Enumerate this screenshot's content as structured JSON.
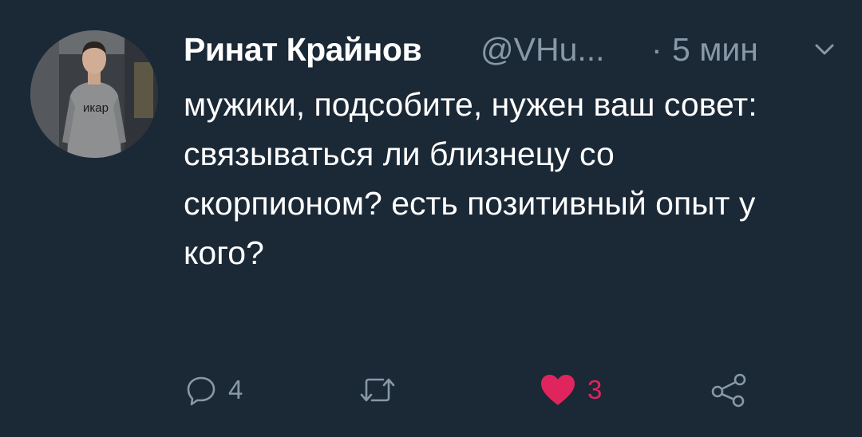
{
  "tweet": {
    "author_name": "Ринат Крайнов",
    "author_handle": "@VHu...",
    "separator": "·",
    "timestamp": "5 мин",
    "body_lines": [
      "мужики, подсобите, нужен ваш совет:",
      "связываться ли близнецу со скорпионом? есть позитивный опыт у кого?"
    ],
    "avatar_shirt_text": "икар"
  },
  "actions": {
    "reply": {
      "icon": "reply-icon",
      "count": "4"
    },
    "retweet": {
      "icon": "retweet-icon",
      "count": ""
    },
    "like": {
      "icon": "heart-icon",
      "count": "3",
      "liked": true
    },
    "share": {
      "icon": "share-icon"
    }
  },
  "colors": {
    "background": "#1b2836",
    "text_primary": "#ffffff",
    "text_secondary": "#8899a6",
    "like_active": "#e0245e"
  }
}
